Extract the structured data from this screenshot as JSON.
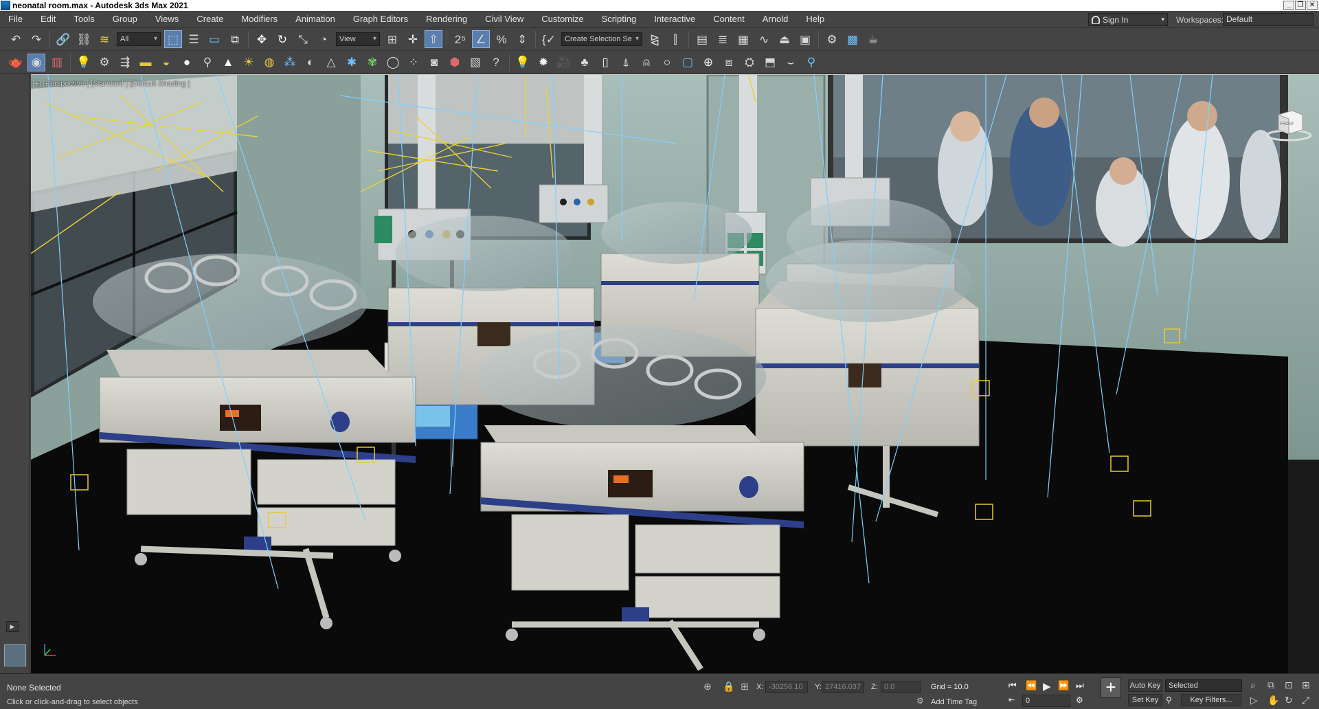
{
  "window": {
    "title": "neonatal room.max - Autodesk 3ds Max 2021"
  },
  "menu": [
    "File",
    "Edit",
    "Tools",
    "Group",
    "Views",
    "Create",
    "Modifiers",
    "Animation",
    "Graph Editors",
    "Rendering",
    "Civil View",
    "Customize",
    "Scripting",
    "Interactive",
    "Content",
    "Arnold",
    "Help"
  ],
  "account": {
    "sign_in": "Sign In",
    "workspaces_label": "Workspaces:",
    "workspace": "Default"
  },
  "toolbar": {
    "selection_filter": "All",
    "ref_coord": "View",
    "named_selection": "Create Selection Se"
  },
  "viewport": {
    "label": "[+] [Perspective ] [Standard ] [Default Shading ]",
    "viewcube_label": "FRONT"
  },
  "status": {
    "selection": "None Selected",
    "prompt": "Click or click-and-drag to select objects",
    "x_label": "X:",
    "x_value": "-30256.10",
    "y_label": "Y:",
    "y_value": "27416.037",
    "z_label": "Z:",
    "z_value": "0.0",
    "grid": "Grid = 10.0",
    "add_time_tag": "Add Time Tag",
    "auto_key": "Auto Key",
    "set_key": "Set Key",
    "key_mode": "Selected",
    "key_filters": "Key Filters...",
    "frame": "0"
  },
  "icons": [
    "undo-icon",
    "redo-icon",
    "link-icon",
    "unlink-icon",
    "bind-space-warp-icon",
    "select-object-icon",
    "select-by-name-icon",
    "rect-selection-icon",
    "window-crossing-icon",
    "move-icon",
    "rotate-icon",
    "scale-icon",
    "placement-icon",
    "pivot-icon",
    "snap-icon",
    "angle-snap-icon",
    "percent-snap-icon",
    "spinner-snap-icon",
    "edit-named-selection-icon",
    "mirror-icon",
    "align-icon",
    "scene-explorer-icon",
    "layer-explorer-icon",
    "ribbon-icon",
    "curve-editor-icon",
    "dope-sheet-icon",
    "schematic-view-icon",
    "material-editor-icon",
    "render-setup-icon",
    "rendered-frame-icon",
    "render-icon"
  ],
  "colors": {
    "ui_bg": "#444444",
    "active_tool": "#5a7fae",
    "light_lines": "#7fd0ff",
    "target_boxes": "#e8c93a"
  }
}
